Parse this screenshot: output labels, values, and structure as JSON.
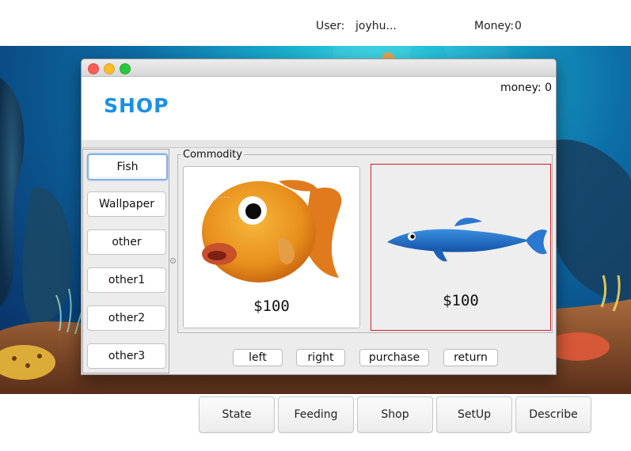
{
  "topbar": {
    "user_label": "User:",
    "user_value": "joyhu...",
    "money_label": "Money:",
    "money_value": "0"
  },
  "window": {
    "title": "SHOP",
    "money_text": "money: 0",
    "categories": [
      "Fish",
      "Wallpaper",
      "other",
      "other1",
      "other2",
      "other3"
    ],
    "commodity_label": "Commodity",
    "items": [
      {
        "icon": "orange-goldfish",
        "price": "$100"
      },
      {
        "icon": "blue-fish",
        "price": "$100"
      }
    ],
    "actions": [
      "left",
      "right",
      "purchase",
      "return"
    ]
  },
  "bottom_buttons": [
    "State",
    "Feeding",
    "Shop",
    "SetUp",
    "Describe"
  ],
  "colors": {
    "shop_title": "#1a8fe8",
    "selected_border": "#d0202a",
    "ocean": "#0d6fa8"
  }
}
